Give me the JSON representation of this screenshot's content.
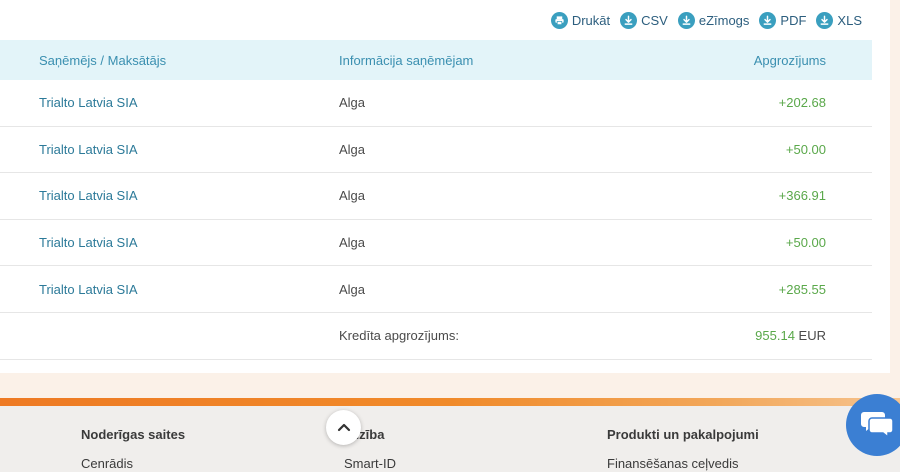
{
  "export": {
    "print": "Drukāt",
    "csv": "CSV",
    "estamp": "eZīmogs",
    "pdf": "PDF",
    "xls": "XLS"
  },
  "table": {
    "headers": [
      "Saņēmējs / Maksātājs",
      "Informācija saņēmējam",
      "Apgrozījums"
    ],
    "rows": [
      {
        "payer": "Trialto Latvia SIA",
        "info": "Alga",
        "amount": "+202.68"
      },
      {
        "payer": "Trialto Latvia SIA",
        "info": "Alga",
        "amount": "+50.00"
      },
      {
        "payer": "Trialto Latvia SIA",
        "info": "Alga",
        "amount": "+366.91"
      },
      {
        "payer": "Trialto Latvia SIA",
        "info": "Alga",
        "amount": "+50.00"
      },
      {
        "payer": "Trialto Latvia SIA",
        "info": "Alga",
        "amount": "+285.55"
      }
    ],
    "total_label": "Kredīta apgrozījums:",
    "total_value": "955.14",
    "total_currency": "EUR"
  },
  "footer": {
    "col1_title": "Noderīgas saites",
    "col1_link": "Cenrādis",
    "col2_title": "līdzība",
    "col2_link": "Smart-ID",
    "col3_title": "Produkti un pakalpojumi",
    "col3_link": "Finansēšanas ceļvedis"
  },
  "colors": {
    "accent": "#3a9fbf",
    "positive": "#5aa84a",
    "header_bg": "#e3f4f9",
    "footer_stripe": "#ee7a23",
    "chat": "#3b7fd3"
  }
}
